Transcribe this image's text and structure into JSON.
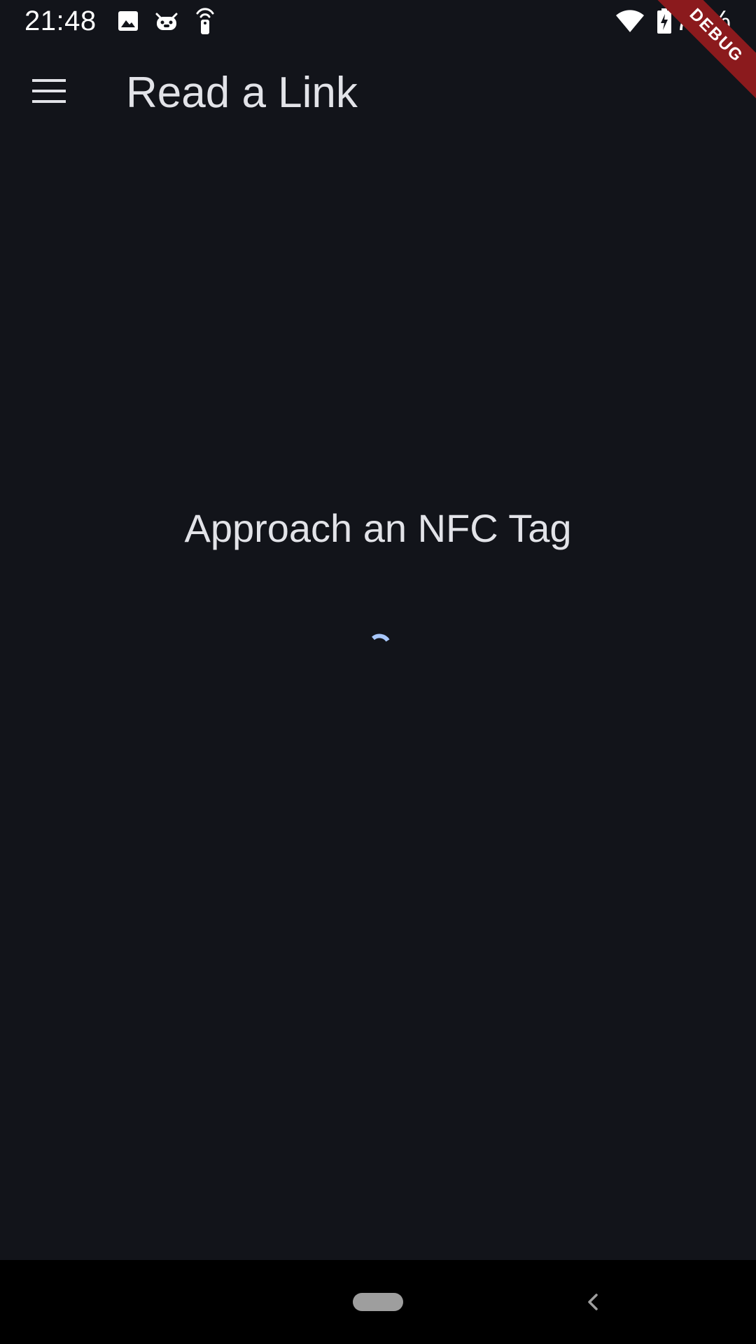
{
  "status_bar": {
    "time": "21:48",
    "battery_percent": "73%",
    "icons": [
      "image-icon",
      "android-debug-icon",
      "nfc-signal-icon",
      "wifi-icon",
      "battery-charging-icon"
    ]
  },
  "debug_banner": {
    "label": "DEBUG",
    "color": "#8b1a1d"
  },
  "app_bar": {
    "title": "Read a Link",
    "menu_icon": "menu-icon"
  },
  "main": {
    "message": "Approach an NFC Tag",
    "loading_indicator": "circular-progress",
    "accent_color": "#a8c7fa"
  },
  "nav_bar": {
    "home_icon": "home-pill",
    "back_icon": "back-icon"
  },
  "colors": {
    "background": "#12141a",
    "text": "#e2e3e8",
    "nav_background": "#000000"
  }
}
